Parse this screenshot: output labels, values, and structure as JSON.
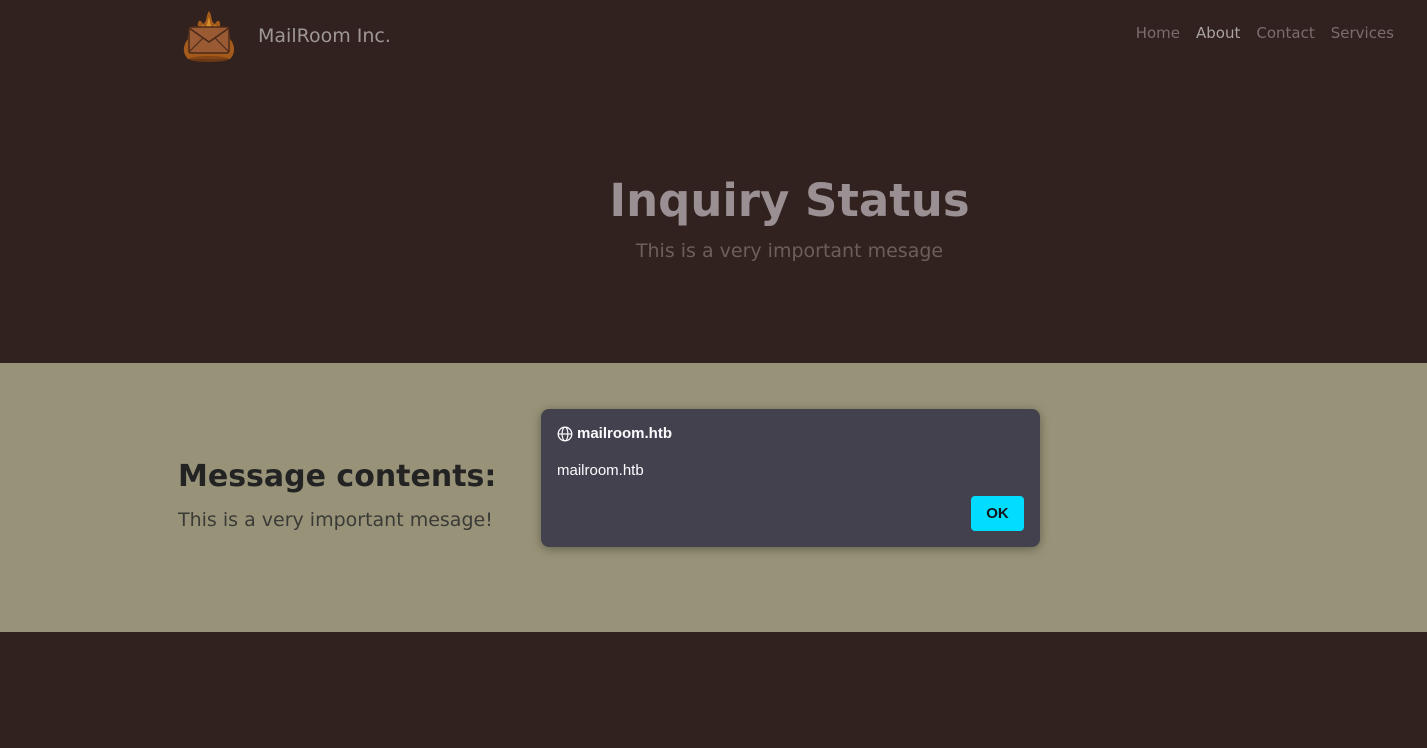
{
  "header": {
    "brand_name": "MailRoom Inc.",
    "logo_icon": "flaming-envelope-logo",
    "nav": [
      {
        "label": "Home",
        "active": false
      },
      {
        "label": "About",
        "active": true
      },
      {
        "label": "Contact",
        "active": false
      },
      {
        "label": "Services",
        "active": false
      }
    ]
  },
  "hero": {
    "title": "Inquiry Status",
    "subtitle": "This is a very important mesage"
  },
  "content": {
    "heading": "Message contents:",
    "body": "This is a very important mesage!"
  },
  "dialog": {
    "icon": "globe-icon",
    "title": "mailroom.htb",
    "message": "mailroom.htb",
    "ok_label": "OK"
  },
  "colors": {
    "page_background": "#31211f",
    "content_band": "#989378",
    "dialog_background": "#42414d",
    "ok_button": "#00ddff"
  }
}
